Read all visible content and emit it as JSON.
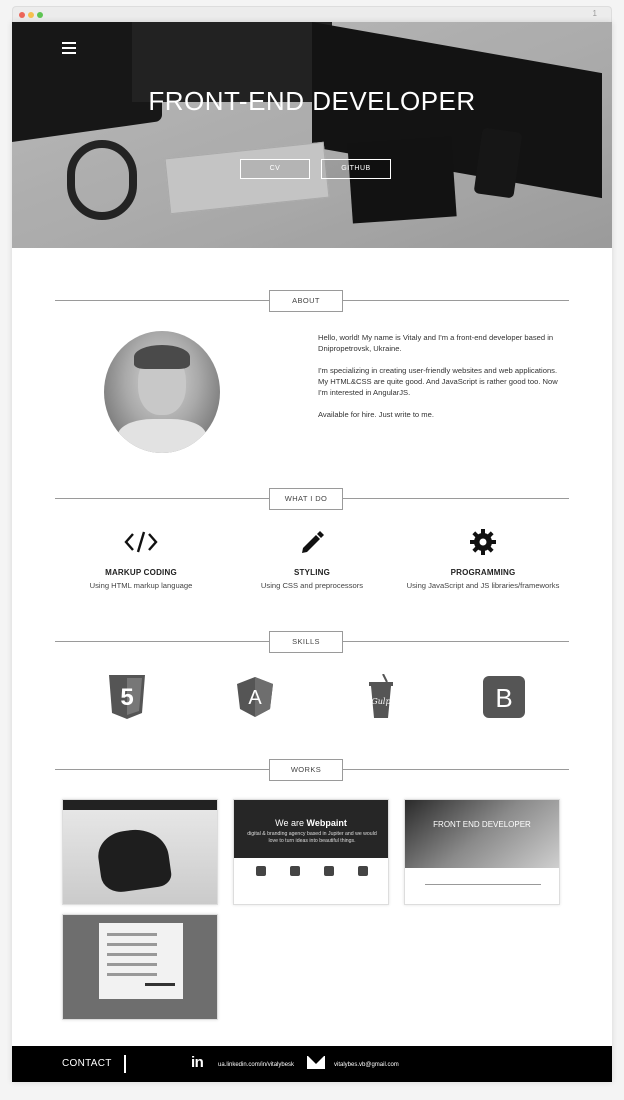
{
  "browser": {
    "tab_number": "1"
  },
  "hero": {
    "title": "FRONT-END DEVELOPER",
    "cv_button": "CV",
    "github_button": "GITHUB"
  },
  "sections": {
    "about": "ABOUT",
    "what_i_do": "WHAT I DO",
    "skills": "SKILLS",
    "works": "WORKS"
  },
  "about": {
    "p1": "Hello, world! My name is Vitaly and I'm a front-end developer based in Dnipropetrovsk, Ukraine.",
    "p2": "I'm specializing in creating user-friendly websites and web applications. My HTML&CSS are quite good. And JavaScript is rather good too. Now I'm interested in AngularJS.",
    "p3": "Available for hire. Just write to me."
  },
  "services": [
    {
      "icon": "code-icon",
      "title": "MARKUP CODING",
      "desc": "Using HTML markup language"
    },
    {
      "icon": "pencil-icon",
      "title": "STYLING",
      "desc": "Using CSS and preprocessors"
    },
    {
      "icon": "gear-icon",
      "title": "PROGRAMMING",
      "desc": "Using JavaScript and JS libraries/frameworks"
    }
  ],
  "skills": [
    "html5-icon",
    "angular-icon",
    "gulp-icon",
    "bootstrap-icon"
  ],
  "works": {
    "work2_title_a": "We are ",
    "work2_title_b": "Webpaint",
    "work2_sub": "digital & branding agency based in Jupiter and we would love to turn ideas into beautiful things.",
    "work3_title": "FRONT END DEVELOPER"
  },
  "footer": {
    "contact": "CONTACT",
    "linkedin": "ua.linkedin.com/in/vitalybesk",
    "linkedin_icon": "in",
    "email": "vitalybes.vb@gmail.com"
  },
  "colors": {
    "footer_bg": "#000000",
    "accent": "#222222"
  }
}
